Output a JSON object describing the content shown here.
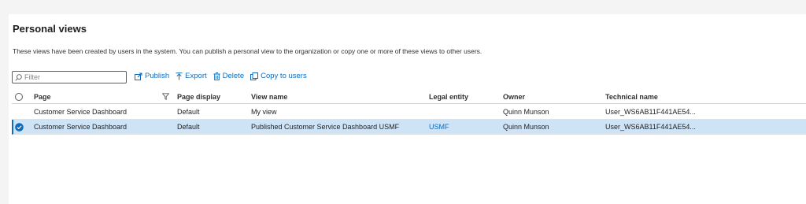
{
  "page": {
    "title": "Personal views",
    "description": "These views have been created by users in the system. You can publish a personal view to the organization or copy one or more of these views to other users."
  },
  "toolbar": {
    "filter_placeholder": "Filter",
    "publish_label": "Publish",
    "export_label": "Export",
    "delete_label": "Delete",
    "copy_label": "Copy to users",
    "icons": [
      "search-icon",
      "publish-icon",
      "export-icon",
      "delete-icon",
      "copy-icon"
    ]
  },
  "grid": {
    "columns": [
      "Page",
      "Page display",
      "View name",
      "Legal entity",
      "Owner",
      "Technical name"
    ],
    "rows": [
      {
        "page": "Customer Service Dashboard",
        "page_display": "Default",
        "view_name": "My view",
        "legal_entity": "",
        "owner": "Quinn Munson",
        "technical_name": "User_WS6AB11F441AE54...",
        "selected": false
      },
      {
        "page": "Customer Service Dashboard",
        "page_display": "Default",
        "view_name": "Published Customer Service Dashboard USMF",
        "legal_entity": "USMF",
        "owner": "Quinn Munson",
        "technical_name": "User_WS6AB11F441AE54...",
        "selected": true
      }
    ]
  },
  "colors": {
    "accent": "#0f6cbd",
    "selected_row": "#cfe3f7",
    "text": "#1f1f1f"
  }
}
